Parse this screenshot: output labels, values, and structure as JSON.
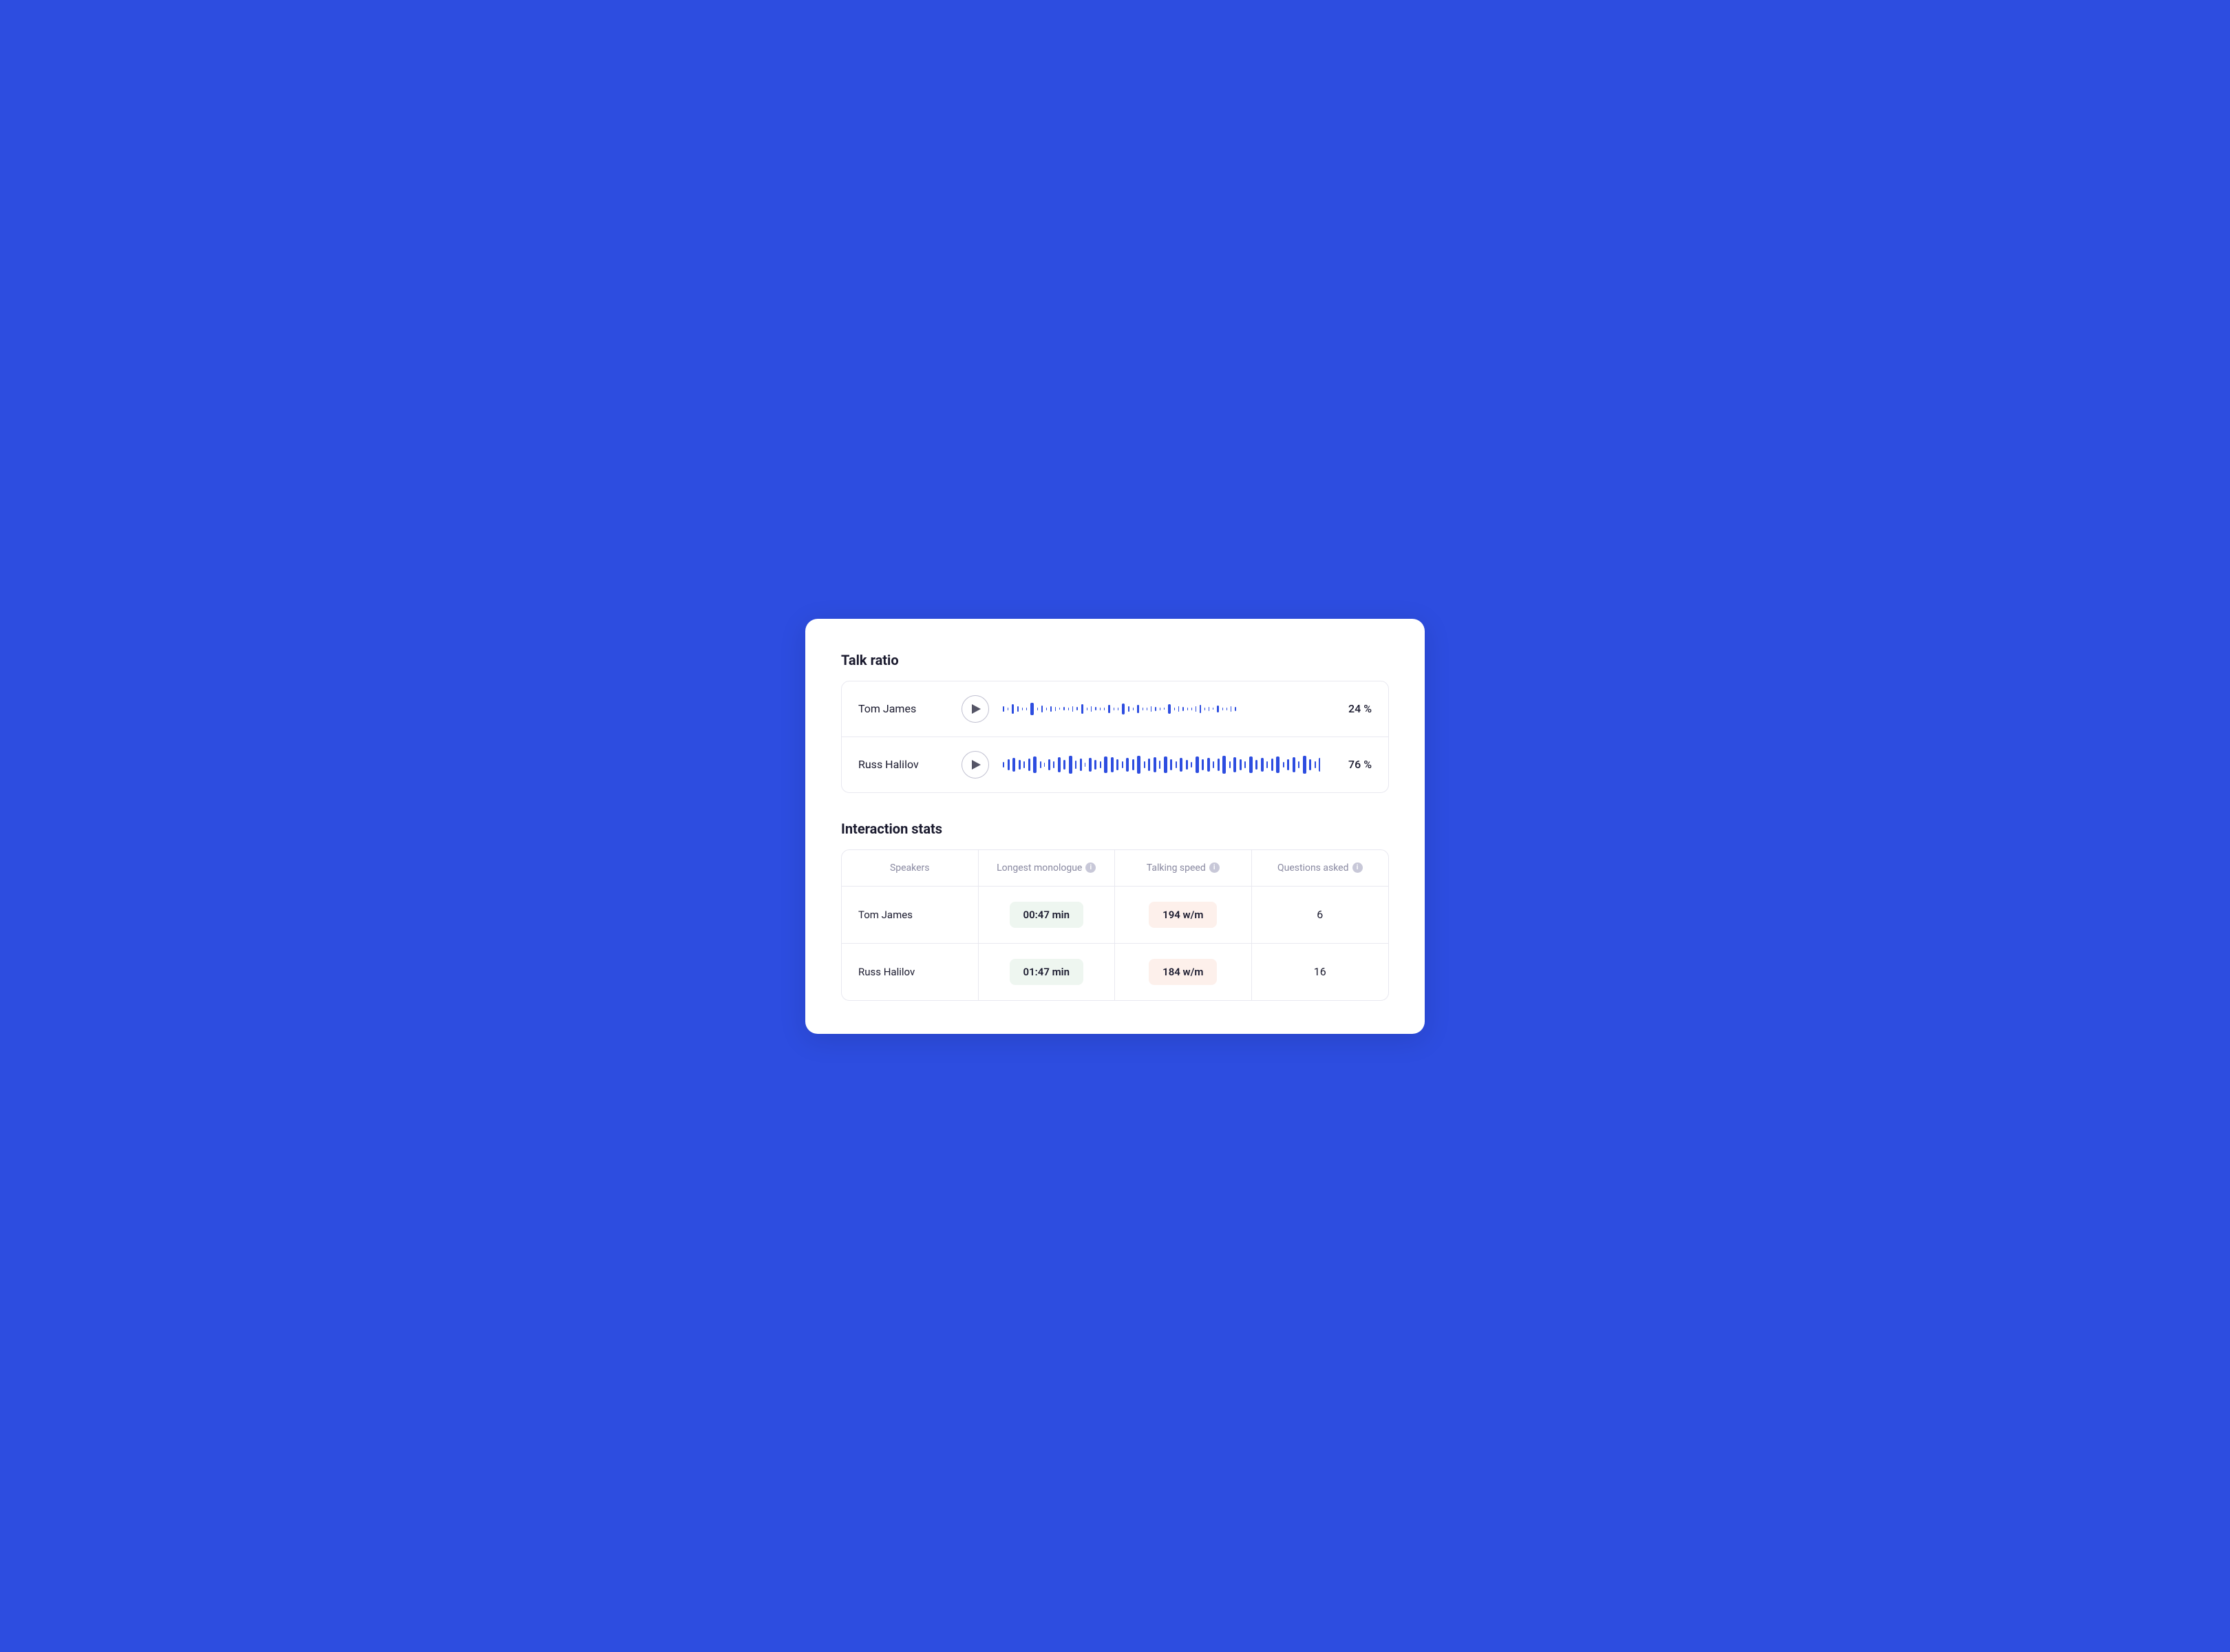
{
  "talkRatio": {
    "sectionTitle": "Talk ratio",
    "speakers": [
      {
        "name": "Tom James",
        "percentage": "24 %",
        "waveform": "sparse"
      },
      {
        "name": "Russ Halilov",
        "percentage": "76 %",
        "waveform": "dense"
      }
    ]
  },
  "interactionStats": {
    "sectionTitle": "Interaction stats",
    "columns": {
      "speakers": "Speakers",
      "monologue": "Longest monologue",
      "speed": "Talking speed",
      "questions": "Questions asked"
    },
    "rows": [
      {
        "speaker": "Tom James",
        "monologue": "00:47 min",
        "speed": "194 w/m",
        "questions": "6"
      },
      {
        "speaker": "Russ Halilov",
        "monologue": "01:47 min",
        "speed": "184 w/m",
        "questions": "16"
      }
    ]
  }
}
